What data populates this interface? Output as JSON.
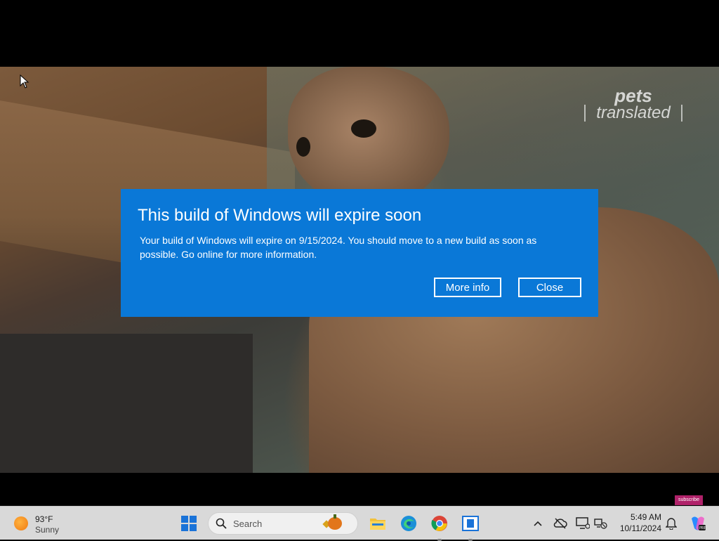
{
  "video": {
    "watermark_line1": "pets",
    "watermark_line2": "translated",
    "subscribe_label": "subscribe"
  },
  "dialog": {
    "title": "This build of Windows will expire soon",
    "body": "Your build of Windows will expire on 9/15/2024. You should move to a new build as soon as possible. Go online for more information.",
    "more_info_label": "More info",
    "close_label": "Close",
    "background_color": "#0a78d7"
  },
  "taskbar": {
    "weather": {
      "temperature": "93°F",
      "condition": "Sunny",
      "icon": "sun-icon"
    },
    "search": {
      "placeholder": "Search"
    },
    "pinned_apps": [
      {
        "name": "File Explorer",
        "icon": "folder-icon"
      },
      {
        "name": "Microsoft Edge",
        "icon": "edge-icon"
      },
      {
        "name": "Google Chrome",
        "icon": "chrome-icon"
      },
      {
        "name": "Window app",
        "icon": "window-icon"
      }
    ],
    "clock": {
      "time": "5:49 AM",
      "date": "10/11/2024"
    }
  }
}
